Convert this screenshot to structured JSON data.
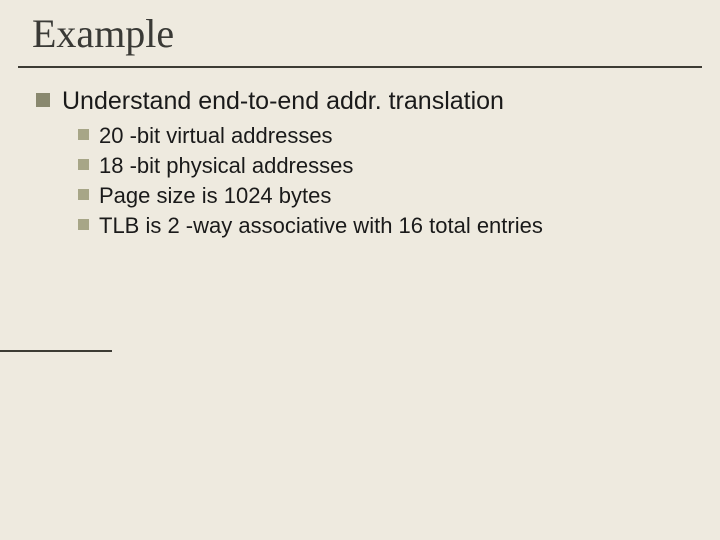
{
  "title": "Example",
  "main": {
    "heading": "Understand end-to-end addr. translation",
    "items": [
      "20 -bit virtual addresses",
      "18 -bit physical addresses",
      "Page size is 1024 bytes",
      "TLB is 2 -way associative with 16 total entries"
    ]
  }
}
